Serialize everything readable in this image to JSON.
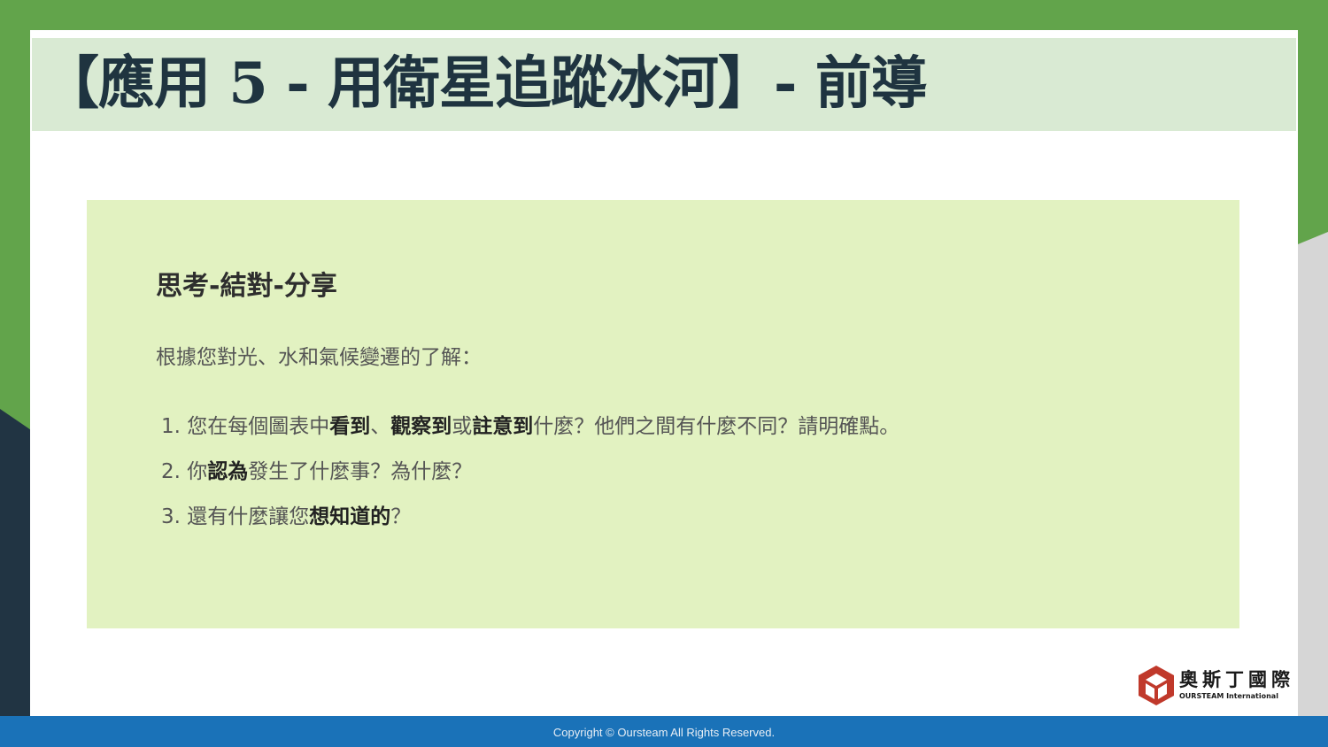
{
  "title": "【應用 5 - 用衛星追蹤冰河】- 前導",
  "panel": {
    "heading": "思考-結對-分享",
    "intro": "根據您對光、水和氣候變遷的了解：",
    "questions": [
      {
        "number": "1.",
        "parts": [
          "您在每個圖表中",
          "看到",
          "、",
          "觀察到",
          "或",
          "註意到",
          "什麼？他們之間有什麼不同？請明確點。"
        ]
      },
      {
        "number": "2.",
        "parts": [
          "你",
          "認為",
          "發生了什麼事？為什麼？"
        ]
      },
      {
        "number": "3.",
        "parts": [
          "還有什麼讓您",
          "想知道的",
          "？"
        ]
      }
    ]
  },
  "logo": {
    "name": "奧斯丁國際",
    "subtitle": "OURSTEAM International"
  },
  "footer": {
    "copyright": "Copyright © Oursteam All Rights Reserved."
  },
  "colors": {
    "green_background": "#62a44b",
    "title_bar": "#d9ead3",
    "panel": "#e2f2c1",
    "footer": "#1a72b8",
    "dark_navy": "#213443",
    "logo_red": "#c0392b"
  }
}
